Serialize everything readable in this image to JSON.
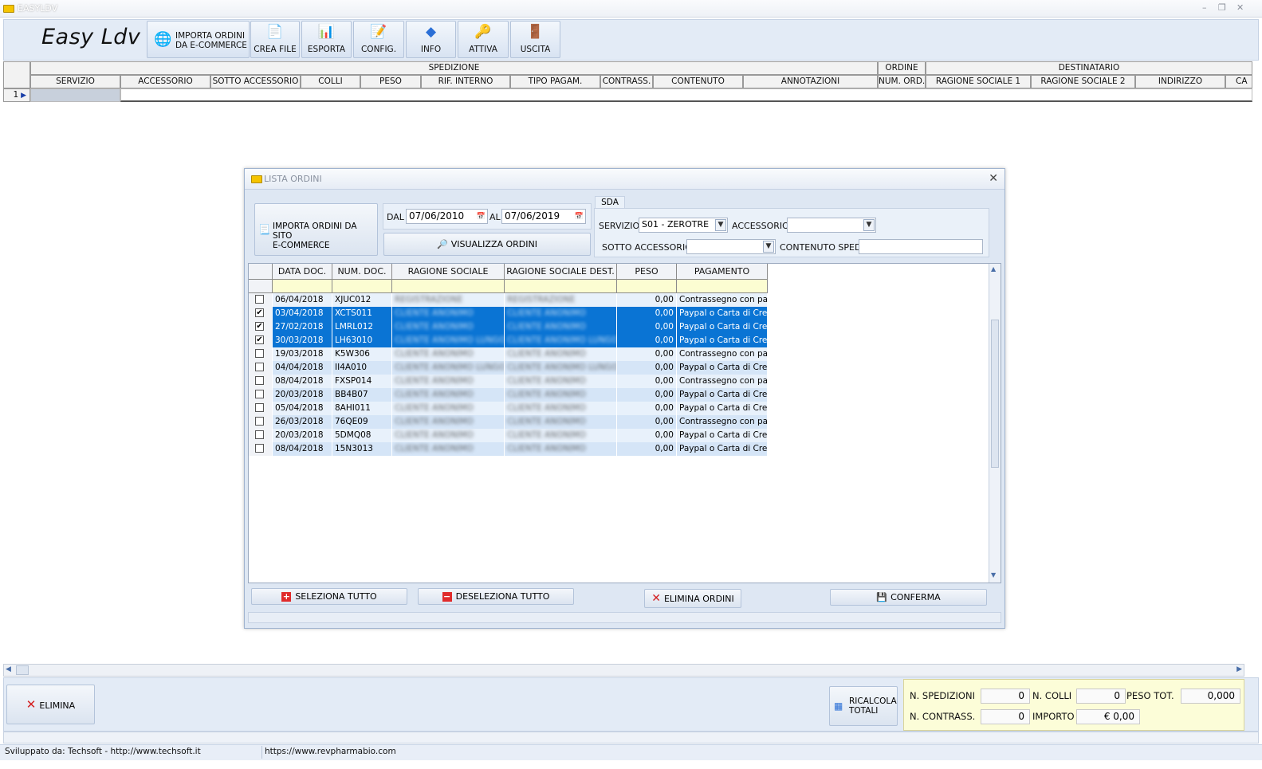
{
  "window": {
    "title": "EASYLDV"
  },
  "app": {
    "logo": "Easy Ldv"
  },
  "toolbar": {
    "import_line1": "IMPORTA ORDINI",
    "import_line2": "DA E-COMMERCE",
    "crea_file": "CREA FILE",
    "esporta": "ESPORTA",
    "config": "CONFIG.",
    "info": "INFO",
    "attiva": "ATTIVA",
    "uscita": "USCITA"
  },
  "main_grid": {
    "groups": {
      "spedizione": "SPEDIZIONE",
      "ordine": "ORDINE",
      "destinatario": "DESTINATARIO"
    },
    "columns": [
      "SERVIZIO",
      "ACCESSORIO",
      "SOTTO ACCESSORIO",
      "COLLI",
      "PESO",
      "RIF. INTERNO",
      "TIPO PAGAM.",
      "CONTRASS.",
      "CONTENUTO",
      "ANNOTAZIONI",
      "NUM. ORD.",
      "RAGIONE SOCIALE 1",
      "RAGIONE SOCIALE 2",
      "INDIRIZZO",
      "CA"
    ],
    "row_number": "1"
  },
  "dialog": {
    "title": "LISTA ORDINI",
    "import_site_line1": "IMPORTA ORDINI DA SITO",
    "import_site_line2": "E-COMMERCE",
    "dal_label": "DAL",
    "dal_value": "07/06/2010",
    "al_label": "AL",
    "al_value": "07/06/2019",
    "visualizza": "VISUALIZZA ORDINI",
    "courier_tab": "SDA",
    "servizio_label": "SERVIZIO",
    "servizio_value": "S01 - ZEROTRE",
    "accessorio_label": "ACCESSORIO",
    "accessorio_value": "",
    "sotto_accessorio_label": "SOTTO ACCESSORIO",
    "sotto_accessorio_value": "",
    "contenuto_label": "CONTENUTO SPED.",
    "contenuto_value": "",
    "columns": [
      "DATA DOC.",
      "NUM. DOC.",
      "RAGIONE SOCIALE",
      "RAGIONE SOCIALE DEST.",
      "PESO",
      "PAGAMENTO"
    ],
    "rows": [
      {
        "checked": false,
        "data": "06/04/2018",
        "num": "XJUC012",
        "rs": "REGISTRAZIONE",
        "rsd": "REGISTRAZIONE",
        "peso": "0,00",
        "pag": "Contrassegno con pagam"
      },
      {
        "checked": true,
        "data": "03/04/2018",
        "num": "XCTS011",
        "rs": "CLIENTE ANONIMO",
        "rsd": "CLIENTE ANONIMO",
        "peso": "0,00",
        "pag": "Paypal o Carta di Credito"
      },
      {
        "checked": true,
        "data": "27/02/2018",
        "num": "LMRL012",
        "rs": "CLIENTE ANONIMO",
        "rsd": "CLIENTE ANONIMO",
        "peso": "0,00",
        "pag": "Paypal o Carta di Credito"
      },
      {
        "checked": true,
        "data": "30/03/2018",
        "num": "LH63010",
        "rs": "CLIENTE ANONIMO LUNGO",
        "rsd": "CLIENTE ANONIMO LUNGO",
        "peso": "0,00",
        "pag": "Paypal o Carta di Credito"
      },
      {
        "checked": false,
        "data": "19/03/2018",
        "num": "K5W306",
        "rs": "CLIENTE ANONIMO",
        "rsd": "CLIENTE ANONIMO",
        "peso": "0,00",
        "pag": "Contrassegno con pagam"
      },
      {
        "checked": false,
        "data": "04/04/2018",
        "num": "II4A010",
        "rs": "CLIENTE ANONIMO LUNGO",
        "rsd": "CLIENTE ANONIMO LUNGO",
        "peso": "0,00",
        "pag": "Paypal o Carta di Credito"
      },
      {
        "checked": false,
        "data": "08/04/2018",
        "num": "FXSP014",
        "rs": "CLIENTE ANONIMO",
        "rsd": "CLIENTE ANONIMO",
        "peso": "0,00",
        "pag": "Contrassegno con pagam"
      },
      {
        "checked": false,
        "data": "20/03/2018",
        "num": "BB4B07",
        "rs": "CLIENTE ANONIMO",
        "rsd": "CLIENTE ANONIMO",
        "peso": "0,00",
        "pag": "Paypal o Carta di Credito"
      },
      {
        "checked": false,
        "data": "05/04/2018",
        "num": "8AHI011",
        "rs": "CLIENTE ANONIMO",
        "rsd": "CLIENTE ANONIMO",
        "peso": "0,00",
        "pag": "Paypal o Carta di Credito"
      },
      {
        "checked": false,
        "data": "26/03/2018",
        "num": "76QE09",
        "rs": "CLIENTE ANONIMO",
        "rsd": "CLIENTE ANONIMO",
        "peso": "0,00",
        "pag": "Contrassegno con pagam"
      },
      {
        "checked": false,
        "data": "20/03/2018",
        "num": "5DMQ08",
        "rs": "CLIENTE ANONIMO",
        "rsd": "CLIENTE ANONIMO",
        "peso": "0,00",
        "pag": "Paypal o Carta di Credito"
      },
      {
        "checked": false,
        "data": "08/04/2018",
        "num": "15N3013",
        "rs": "CLIENTE ANONIMO",
        "rsd": "CLIENTE ANONIMO",
        "peso": "0,00",
        "pag": "Paypal o Carta di Credito"
      }
    ],
    "btn_select_all": "SELEZIONA TUTTO",
    "btn_deselect_all": "DESELEZIONA TUTTO",
    "btn_delete_orders": "ELIMINA ORDINI",
    "btn_confirm": "CONFERMA"
  },
  "bottom": {
    "elimina": "ELIMINA",
    "ricalcola_line1": "RICALCOLA",
    "ricalcola_line2": "TOTALI",
    "n_spedizioni_label": "N. SPEDIZIONI",
    "n_spedizioni": "0",
    "n_colli_label": "N. COLLI",
    "n_colli": "0",
    "peso_tot_label": "PESO TOT.",
    "peso_tot": "0,000",
    "n_contrass_label": "N. CONTRASS.",
    "n_contrass": "0",
    "importo_label": "IMPORTO",
    "importo": "€ 0,00"
  },
  "status": {
    "developer": "Sviluppato da: Techsoft - http://www.techsoft.it",
    "url": "https://www.revpharmabio.com"
  },
  "colors": {
    "selection": "#0a74d4",
    "row_alt": "#d5e5f7",
    "filter_row": "#fcfdd2"
  }
}
